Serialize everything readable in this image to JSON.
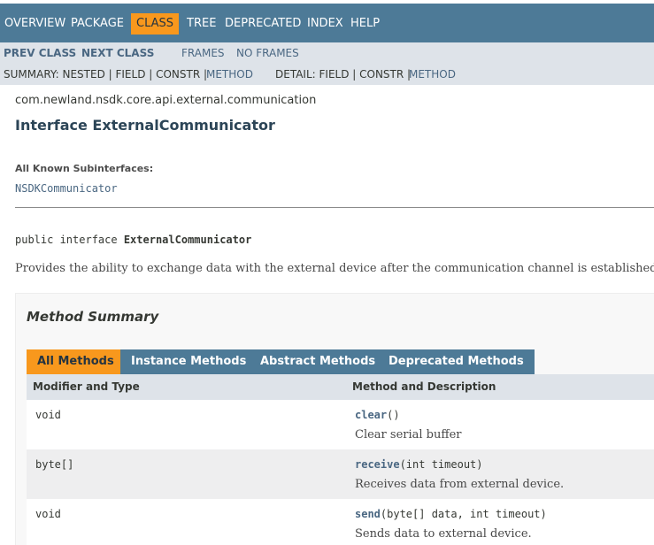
{
  "topnav": {
    "items": [
      "OVERVIEW",
      "PACKAGE",
      "CLASS",
      "TREE",
      "DEPRECATED",
      "INDEX",
      "HELP"
    ],
    "active": "CLASS"
  },
  "subnav": {
    "prev_class": "PREV CLASS",
    "next_class": "NEXT CLASS",
    "frames": "FRAMES",
    "no_frames": "NO FRAMES",
    "summary_label": "SUMMARY: NESTED | FIELD | CONSTR |",
    "summary_method": "METHOD",
    "detail_label": "DETAIL: FIELD | CONSTR |",
    "detail_method": "METHOD"
  },
  "header": {
    "package": "com.newland.nsdk.core.api.external.communication",
    "title": "Interface ExternalCommunicator"
  },
  "known_subinterfaces": {
    "label": "All Known Subinterfaces:",
    "link": "NSDKCommunicator"
  },
  "signature": {
    "prefix": "public interface ",
    "name": "ExternalCommunicator"
  },
  "description": "Provides the ability to exchange data with the external device after the communication channel is established.",
  "method_summary": {
    "title": "Method Summary",
    "tabs": [
      "All Methods",
      "Instance Methods",
      "Abstract Methods",
      "Deprecated Methods"
    ],
    "active_tab": "All Methods",
    "columns": [
      "Modifier and Type",
      "Method and Description"
    ],
    "rows": [
      {
        "type": "void",
        "name": "clear",
        "params": "()",
        "desc": "Clear serial buffer"
      },
      {
        "type": "byte[]",
        "name": "receive",
        "params": "(int timeout)",
        "desc": "Receives data from external device."
      },
      {
        "type": "void",
        "name": "send",
        "params": "(byte[] data, int timeout)",
        "desc": "Sends data to external device."
      }
    ]
  },
  "colors": {
    "nav_bg": "#4d7a97",
    "active_tab": "#f8981d",
    "subnav_bg": "#dee3e9",
    "link": "#4a6782"
  }
}
